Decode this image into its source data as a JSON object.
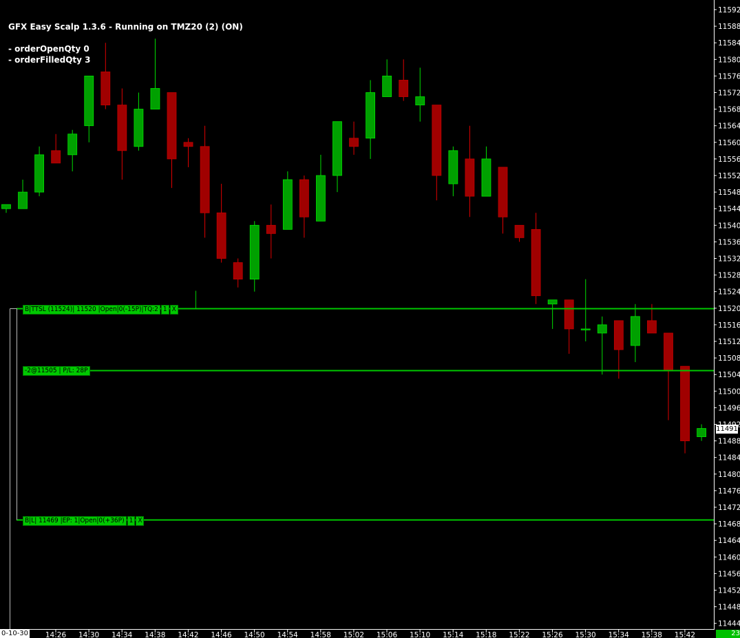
{
  "indicator": {
    "title": "GFX Easy Scalp 1.3.6 - Running on TMZ20 (2) (ON)",
    "line1": "- orderOpenQty 0",
    "line2": "- orderFilledQty 3"
  },
  "orders": {
    "stop": {
      "price": 11520,
      "segments": [
        "B|TTSL (11524)| 11520 |Open|0(-15P)|TQ:2",
        "1",
        "X"
      ]
    },
    "position": {
      "price": 11505,
      "segments": [
        "-2@11505 | P/L: 28P"
      ]
    },
    "limit": {
      "price": 11469,
      "segments": [
        "B|L| 11469 |EP: 1|Open|0(+36P)",
        "1",
        "X"
      ]
    }
  },
  "last_price": "11491",
  "date_label": "0-10-30",
  "corner_label": "23",
  "colors": {
    "background": "#000000",
    "bull": "#00a000",
    "bull_wick": "#00e000",
    "bear": "#a00000",
    "bear_wick": "#e00000",
    "order_line": "#00c800",
    "axis_text": "#ffffff"
  },
  "chart_data": {
    "type": "candlestick",
    "y_axis_ticks": [
      11592,
      11588,
      11584,
      11580,
      11576,
      11572,
      11568,
      11564,
      11560,
      11556,
      11552,
      11548,
      11544,
      11540,
      11536,
      11532,
      11528,
      11524,
      11520,
      11516,
      11512,
      11508,
      11504,
      11500,
      11496,
      11492,
      11488,
      11484,
      11480,
      11476,
      11472,
      11468,
      11464,
      11460,
      11456,
      11452,
      11448,
      11444
    ],
    "x_axis_ticks": [
      "14:26",
      "14:30",
      "14:34",
      "14:38",
      "14:42",
      "14:46",
      "14:50",
      "14:54",
      "14:58",
      "15:02",
      "15:06",
      "15:10",
      "15:14",
      "15:18",
      "15:22",
      "15:26",
      "15:30",
      "15:34",
      "15:38",
      "15:42"
    ],
    "candles": [
      {
        "o": 11544,
        "h": 11545,
        "l": 11543,
        "c": 11545
      },
      {
        "o": 11544,
        "h": 11551,
        "l": 11544,
        "c": 11548
      },
      {
        "o": 11548,
        "h": 11559,
        "l": 11547,
        "c": 11557
      },
      {
        "o": 11558,
        "h": 11562,
        "l": 11555,
        "c": 11555
      },
      {
        "o": 11557,
        "h": 11563,
        "l": 11553,
        "c": 11562
      },
      {
        "o": 11564,
        "h": 11576,
        "l": 11560,
        "c": 11576
      },
      {
        "o": 11577,
        "h": 11584,
        "l": 11568,
        "c": 11569
      },
      {
        "o": 11569,
        "h": 11573,
        "l": 11551,
        "c": 11558
      },
      {
        "o": 11559,
        "h": 11572,
        "l": 11558,
        "c": 11568
      },
      {
        "o": 11568,
        "h": 11585,
        "l": 11568,
        "c": 11573
      },
      {
        "o": 11572,
        "h": 11572,
        "l": 11549,
        "c": 11556
      },
      {
        "o": 11560,
        "h": 11561,
        "l": 11554,
        "c": 11559
      },
      {
        "o": 11559,
        "h": 11564,
        "l": 11537,
        "c": 11543
      },
      {
        "o": 11543,
        "h": 11550,
        "l": 11531,
        "c": 11532
      },
      {
        "o": 11531,
        "h": 11532,
        "l": 11525,
        "c": 11527
      },
      {
        "o": 11527,
        "h": 11541,
        "l": 11524,
        "c": 11540
      },
      {
        "o": 11540,
        "h": 11545,
        "l": 11532,
        "c": 11538
      },
      {
        "o": 11539,
        "h": 11553,
        "l": 11539,
        "c": 11551
      },
      {
        "o": 11551,
        "h": 11552,
        "l": 11537,
        "c": 11542
      },
      {
        "o": 11541,
        "h": 11557,
        "l": 11541,
        "c": 11552
      },
      {
        "o": 11552,
        "h": 11565,
        "l": 11548,
        "c": 11565
      },
      {
        "o": 11561,
        "h": 11565,
        "l": 11557,
        "c": 11559
      },
      {
        "o": 11561,
        "h": 11575,
        "l": 11556,
        "c": 11572
      },
      {
        "o": 11571,
        "h": 11580,
        "l": 11571,
        "c": 11576
      },
      {
        "o": 11575,
        "h": 11580,
        "l": 11570,
        "c": 11571
      },
      {
        "o": 11569,
        "h": 11578,
        "l": 11565,
        "c": 11571
      },
      {
        "o": 11569,
        "h": 11569,
        "l": 11546,
        "c": 11552
      },
      {
        "o": 11550,
        "h": 11559,
        "l": 11547,
        "c": 11558
      },
      {
        "o": 11556,
        "h": 11564,
        "l": 11542,
        "c": 11547
      },
      {
        "o": 11547,
        "h": 11559,
        "l": 11547,
        "c": 11556
      },
      {
        "o": 11554,
        "h": 11548,
        "l": 11538,
        "c": 11542
      },
      {
        "o": 11540,
        "h": 11540,
        "l": 11536,
        "c": 11537
      },
      {
        "o": 11539,
        "h": 11543,
        "l": 11521,
        "c": 11523
      },
      {
        "o": 11521,
        "h": 11522,
        "l": 11515,
        "c": 11522
      },
      {
        "o": 11522,
        "h": 11522,
        "l": 11509,
        "c": 11515
      },
      {
        "o": 11515,
        "h": 11527,
        "l": 11512,
        "c": 11515
      },
      {
        "o": 11514,
        "h": 11518,
        "l": 11504,
        "c": 11516
      },
      {
        "o": 11517,
        "h": 11517,
        "l": 11503,
        "c": 11510
      },
      {
        "o": 11511,
        "h": 11521,
        "l": 11507,
        "c": 11518
      },
      {
        "o": 11517,
        "h": 11521,
        "l": 11515,
        "c": 11514
      },
      {
        "o": 11514,
        "h": 11514,
        "l": 11493,
        "c": 11505
      },
      {
        "o": 11506,
        "h": 11506,
        "l": 11485,
        "c": 11488
      },
      {
        "o": 11489,
        "h": 11492,
        "l": 11488,
        "c": 11491
      }
    ]
  }
}
